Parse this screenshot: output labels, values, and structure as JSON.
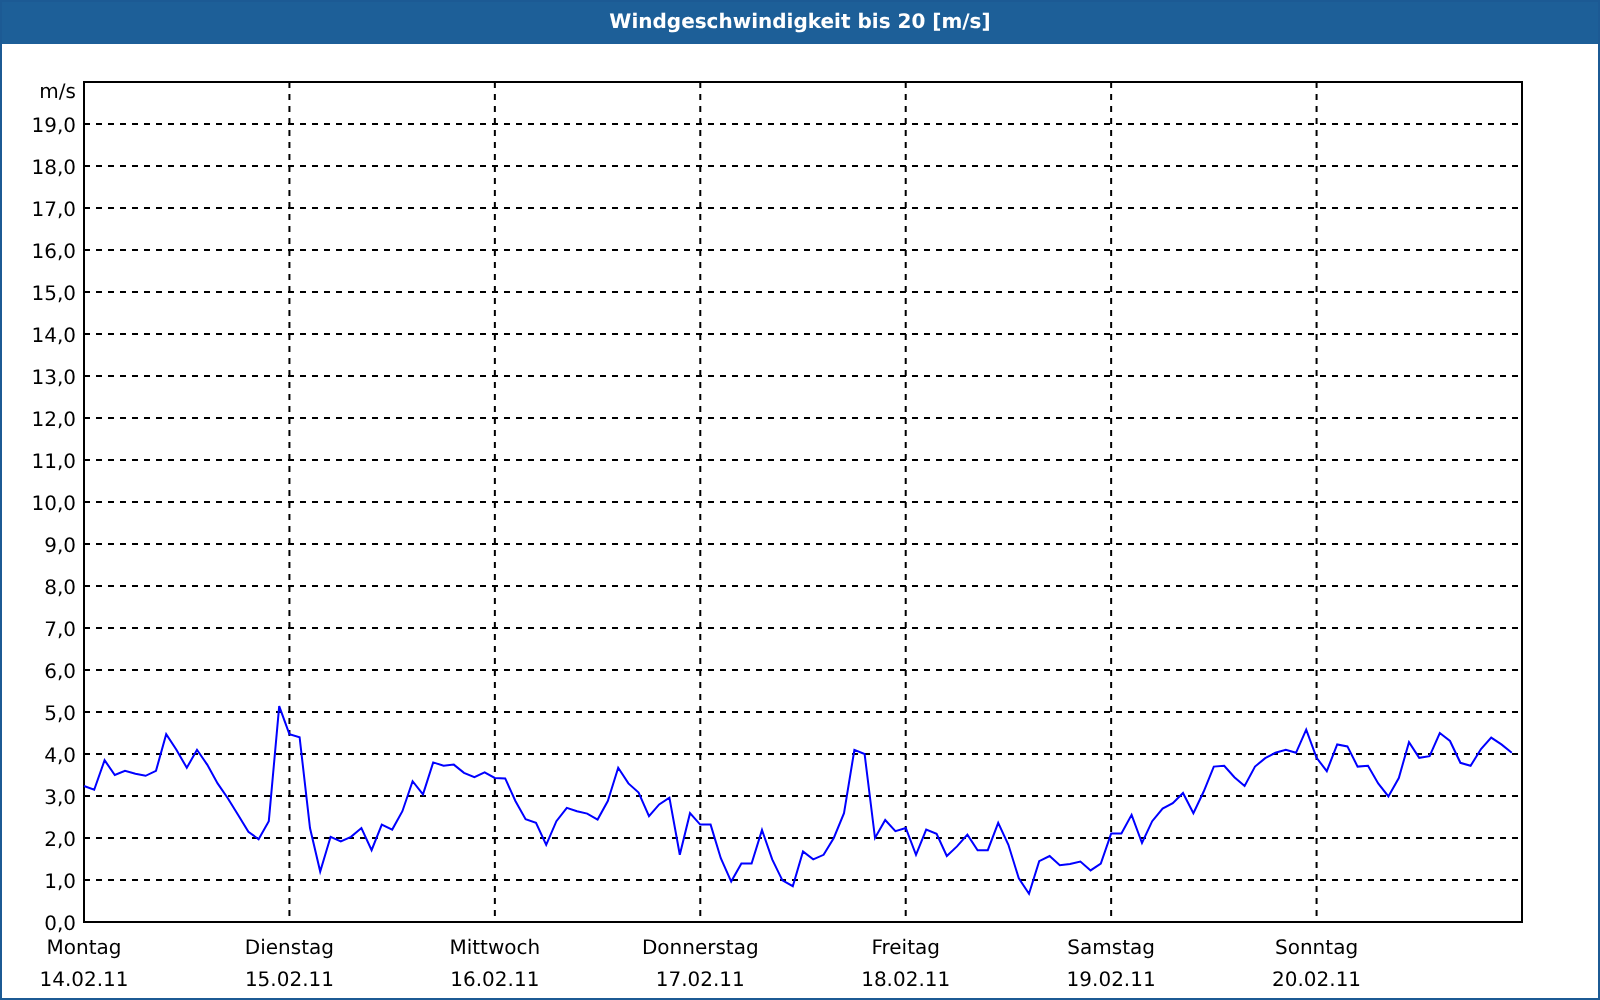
{
  "window": {
    "title": "Windgeschwindigkeit bis 20 [m/s]"
  },
  "chart": {
    "chart_data": {
      "type": "line",
      "grid": true,
      "ylabel": "m/s",
      "ylim": [
        0,
        20
      ],
      "yticks": [
        {
          "value": 0,
          "label": "0,0"
        },
        {
          "value": 1,
          "label": "1,0"
        },
        {
          "value": 2,
          "label": "2,0"
        },
        {
          "value": 3,
          "label": "3,0"
        },
        {
          "value": 4,
          "label": "4,0"
        },
        {
          "value": 5,
          "label": "5,0"
        },
        {
          "value": 6,
          "label": "6,0"
        },
        {
          "value": 7,
          "label": "7,0"
        },
        {
          "value": 8,
          "label": "8,0"
        },
        {
          "value": 9,
          "label": "9,0"
        },
        {
          "value": 10,
          "label": "10,0"
        },
        {
          "value": 11,
          "label": "11,0"
        },
        {
          "value": 12,
          "label": "12,0"
        },
        {
          "value": 13,
          "label": "13,0"
        },
        {
          "value": 14,
          "label": "14,0"
        },
        {
          "value": 15,
          "label": "15,0"
        },
        {
          "value": 16,
          "label": "16,0"
        },
        {
          "value": 17,
          "label": "17,0"
        },
        {
          "value": 18,
          "label": "18,0"
        },
        {
          "value": 19,
          "label": "19,0"
        }
      ],
      "categories": [
        "Montag",
        null,
        null,
        null,
        null,
        null,
        null,
        null,
        null,
        null,
        null,
        null,
        null,
        null,
        null,
        null,
        null,
        null,
        null,
        null,
        "Dienstag",
        null,
        null,
        null,
        null,
        null,
        null,
        null,
        null,
        null,
        null,
        null,
        null,
        null,
        null,
        null,
        null,
        null,
        null,
        null,
        "Mittwoch",
        null,
        null,
        null,
        null,
        null,
        null,
        null,
        null,
        null,
        null,
        null,
        null,
        null,
        null,
        null,
        null,
        null,
        null,
        null,
        "Donnerstag",
        null,
        null,
        null,
        null,
        null,
        null,
        null,
        null,
        null,
        null,
        null,
        null,
        null,
        null,
        null,
        null,
        null,
        null,
        null,
        "Freitag",
        null,
        null,
        null,
        null,
        null,
        null,
        null,
        null,
        null,
        null,
        null,
        null,
        null,
        null,
        null,
        null,
        null,
        null,
        null,
        "Samstag",
        null,
        null,
        null,
        null,
        null,
        null,
        null,
        null,
        null,
        null,
        null,
        null,
        null,
        null,
        null,
        null,
        null,
        null,
        null,
        "Sonntag",
        null,
        null,
        null,
        null,
        null,
        null,
        null,
        null,
        null,
        null,
        null,
        null,
        null,
        null,
        null,
        null,
        null,
        null,
        null
      ],
      "series": [
        {
          "color": "#0000ff",
          "values": [
            3.24,
            3.15,
            3.85,
            3.5,
            3.6,
            3.53,
            3.48,
            3.6,
            4.47,
            4.1,
            3.67,
            4.1,
            3.75,
            3.3,
            2.95,
            2.55,
            2.15,
            1.97,
            2.4,
            5.14,
            4.47,
            4.4,
            2.24,
            1.2,
            2.03,
            1.92,
            2.03,
            2.24,
            1.71,
            2.32,
            2.2,
            2.64,
            3.35,
            3.04,
            3.8,
            3.72,
            3.75,
            3.55,
            3.45,
            3.56,
            3.43,
            3.42,
            2.88,
            2.45,
            2.36,
            1.84,
            2.4,
            2.72,
            2.64,
            2.58,
            2.44,
            2.88,
            3.67,
            3.3,
            3.08,
            2.52,
            2.8,
            2.96,
            1.6,
            2.59,
            2.32,
            2.32,
            1.52,
            0.96,
            1.39,
            1.39,
            2.19,
            1.49,
            0.99,
            0.85,
            1.68,
            1.49,
            1.6,
            2.0,
            2.59,
            4.1,
            4.0,
            2.0,
            2.43,
            2.16,
            2.24,
            1.6,
            2.2,
            2.1,
            1.57,
            1.8,
            2.08,
            1.71,
            1.71,
            2.36,
            1.84,
            1.04,
            0.67,
            1.45,
            1.57,
            1.35,
            1.38,
            1.44,
            1.23,
            1.39,
            2.11,
            2.11,
            2.55,
            1.88,
            2.4,
            2.7,
            2.83,
            3.07,
            2.59,
            3.1,
            3.7,
            3.72,
            3.45,
            3.24,
            3.7,
            3.9,
            4.03,
            4.1,
            4.03,
            4.58,
            3.91,
            3.59,
            4.23,
            4.18,
            3.7,
            3.72,
            3.3,
            2.99,
            3.43,
            4.28,
            3.91,
            3.95,
            4.5,
            4.31,
            3.79,
            3.72,
            4.12,
            4.39,
            4.23,
            4.03
          ]
        }
      ]
    },
    "date_labels": [
      "14.02.11",
      "15.02.11",
      "16.02.11",
      "17.02.11",
      "18.02.11",
      "19.02.11",
      "20.02.11"
    ]
  }
}
